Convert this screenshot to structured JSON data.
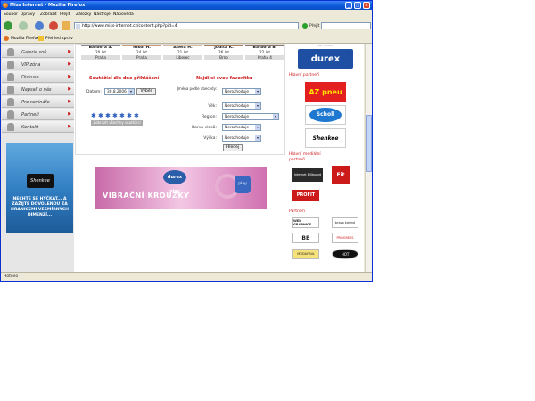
{
  "window": {
    "title": "Miss Internet - Mozilla Firefox"
  },
  "menu": [
    "Soubor",
    "Úpravy",
    "Zobrazit",
    "Přejít",
    "Záložky",
    "Nástroje",
    "Nápověda"
  ],
  "address": {
    "url": "http://www.miss-internet.cz/content.php?pid=4",
    "go_label": "Přejít"
  },
  "bookmarks": [
    "Mozilla Firefox",
    "Přehled zpráv"
  ],
  "status": "Hotovo",
  "nav": [
    {
      "label": "Galerie snů"
    },
    {
      "label": "VIP zóna"
    },
    {
      "label": "Diskuse"
    },
    {
      "label": "Napsali o nás"
    },
    {
      "label": "Pro novináře"
    },
    {
      "label": "Partneři"
    },
    {
      "label": "Kontakt"
    }
  ],
  "shenkee_ad": {
    "logo": "Shenkee",
    "text": "NECHTE SE HÝČKAT... A ZAŽIJTE DOVOLENOU ZA HRANICEMI VESMÍRNÝCH DIMENZÍ..."
  },
  "finalists": [
    {
      "name": "Barbora S.",
      "age": "20 let",
      "city": "Praha",
      "color": "#8a8a8a"
    },
    {
      "name": "Nikol H.",
      "age": "24 let",
      "city": "Praha",
      "color": "#c79a7a"
    },
    {
      "name": "Adéla H.",
      "age": "21 let",
      "city": "Liberec",
      "color": "#d7b8a0"
    },
    {
      "name": "Judita K.",
      "age": "26 let",
      "city": "Brno",
      "color": "#a9825e"
    },
    {
      "name": "Barbora B.",
      "age": "22 let",
      "city": "Praha 4",
      "color": "#8d7a6c"
    }
  ],
  "daily_contest": {
    "title": "Soutěžící dle dne přihlášení",
    "date_label": "Datum:",
    "date_value": "30.8.2006",
    "choose_label": "Výběr",
    "stars": 7,
    "bar_label": "Zobrazit všechny soutěžící dne"
  },
  "find_favorite": {
    "title": "Najdi si svou favoritku",
    "rows": [
      {
        "label": "Jména podle abecedy:",
        "value": "Nerozhoduje"
      },
      {
        "label": "Věk:",
        "value": "Nerozhoduje"
      },
      {
        "label": "Region:",
        "value": "Nerozhoduje"
      },
      {
        "label": "Barva vlasů:",
        "value": "Nerozhoduje"
      },
      {
        "label": "Výška:",
        "value": "Nerozhoduje"
      }
    ],
    "search_label": "Hledej"
  },
  "banner": {
    "text": "VIBRAČNÍ KROUŽKY",
    "logo": "durex play",
    "badge": "play"
  },
  "sponsors": {
    "main_partners_title": "Hlavní partneři",
    "media_partners_title": "Hlavní mediální partneři",
    "partners_title": "Partneři",
    "top_label": "GET READY",
    "durex": "durex",
    "az": "AZ pneu",
    "scholl": "Scholl",
    "shenkee": "Shenkee",
    "billboard": "Internet Billboard",
    "fit": "Fit",
    "profit": "PROFIT",
    "p1": "WEB GRAPHICS",
    "p2": "bravo kasinó",
    "p3": "BB",
    "p4": "PROGRESS",
    "p5": "MODAFINIL",
    "p6": "HOT"
  },
  "colors": {
    "accent": "#cc1a1a",
    "link_blue": "#2456b8",
    "title_bar": "#0a58d8"
  }
}
